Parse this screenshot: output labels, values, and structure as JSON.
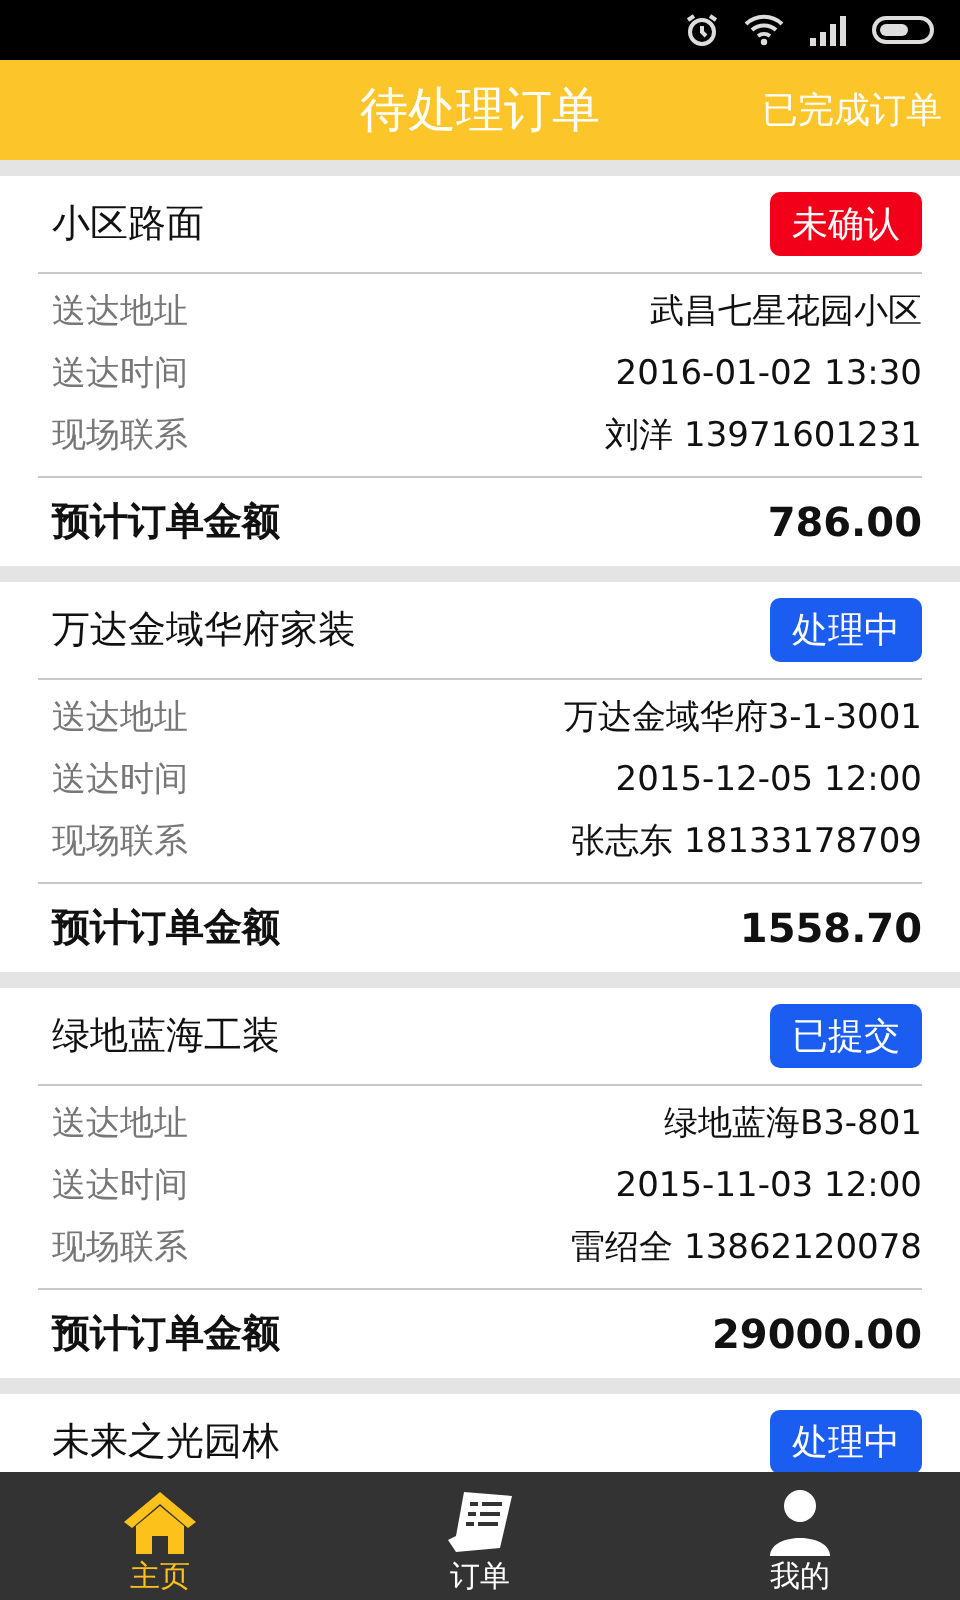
{
  "header": {
    "title": "待处理订单",
    "action": "已完成订单"
  },
  "orders": [
    {
      "title": "小区路面",
      "status": "未确认",
      "color": "#f20019",
      "rows": [
        {
          "label": "送达地址",
          "value": "武昌七星花园小区"
        },
        {
          "label": "送达时间",
          "value": "2016-01-02 13:30"
        },
        {
          "label": "现场联系",
          "value": "刘洋 13971601231"
        }
      ],
      "total_label": "预计订单金额",
      "total": "786.00"
    },
    {
      "title": "万达金域华府家装",
      "status": "处理中",
      "color": "#1a5df0",
      "rows": [
        {
          "label": "送达地址",
          "value": "万达金域华府3-1-3001"
        },
        {
          "label": "送达时间",
          "value": "2015-12-05 12:00"
        },
        {
          "label": "现场联系",
          "value": "张志东 18133178709"
        }
      ],
      "total_label": "预计订单金额",
      "total": "1558.70"
    },
    {
      "title": "绿地蓝海工装",
      "status": "已提交",
      "color": "#1a5df0",
      "rows": [
        {
          "label": "送达地址",
          "value": "绿地蓝海B3-801"
        },
        {
          "label": "送达时间",
          "value": "2015-11-03 12:00"
        },
        {
          "label": "现场联系",
          "value": "雷绍全 13862120078"
        }
      ],
      "total_label": "预计订单金额",
      "total": "29000.00"
    },
    {
      "title": "未来之光园林",
      "status": "处理中",
      "color": "#1a5df0"
    }
  ],
  "nav": [
    {
      "kind": "home",
      "label": "主页",
      "selected": true
    },
    {
      "kind": "orders",
      "label": "订单",
      "selected": false
    },
    {
      "kind": "profile",
      "label": "我的",
      "selected": false
    }
  ]
}
